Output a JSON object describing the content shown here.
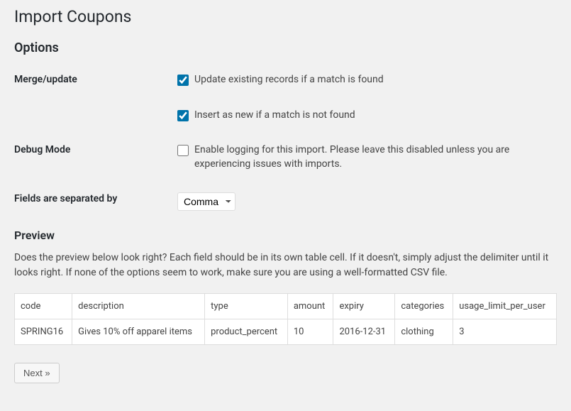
{
  "page_title": "Import Coupons",
  "sections": {
    "options_heading": "Options",
    "preview_heading": "Preview"
  },
  "options": {
    "merge_update": {
      "label": "Merge/update",
      "update_existing": {
        "checked": true,
        "text": "Update existing records if a match is found"
      },
      "insert_new": {
        "checked": true,
        "text": "Insert as new if a match is not found"
      }
    },
    "debug_mode": {
      "label": "Debug Mode",
      "enable_logging": {
        "checked": false,
        "text": "Enable logging for this import. Please leave this disabled unless you are experiencing issues with imports."
      }
    },
    "delimiter": {
      "label": "Fields are separated by",
      "selected": "Comma"
    }
  },
  "preview": {
    "description": "Does the preview below look right? Each field should be in its own table cell. If it doesn't, simply adjust the delimiter until it looks right. If none of the options seem to work, make sure you are using a well-formatted CSV file.",
    "headers": {
      "code": "code",
      "description": "description",
      "type": "type",
      "amount": "amount",
      "expiry": "expiry",
      "categories": "categories",
      "usage_limit_per_user": "usage_limit_per_user"
    },
    "row": {
      "code": "SPRING16",
      "description": "Gives 10% off apparel items",
      "type": "product_percent",
      "amount": "10",
      "expiry": "2016-12-31",
      "categories": "clothing",
      "usage_limit_per_user": "3"
    }
  },
  "buttons": {
    "next": "Next »"
  }
}
